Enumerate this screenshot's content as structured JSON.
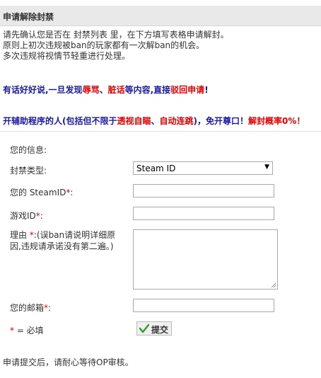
{
  "header": {
    "title": "申请解除封禁"
  },
  "intro": {
    "line1": "请先确认您是否在 封禁列表 里，在下方填写表格申请解封。",
    "line2": "原则上初次违规被ban的玩家都有一次解ban的机会。",
    "line3": "多次违规将视情节轻重进行处理。"
  },
  "warning1": {
    "p1": "有话好好说,一旦发现",
    "p2": "辱骂",
    "p3": "、",
    "p4": "脏话",
    "p5": "等内容,直接",
    "p6": "驳回申请",
    "p7": "!"
  },
  "warning2": {
    "p1": "开辅助程序的人(包括但不限于",
    "p2": "透视自瞄",
    "p3": "、",
    "p4": "自动连跳",
    "p5": ")，免开尊口！",
    "p6": "解封概率0%！"
  },
  "form": {
    "info_label": "您的信息:",
    "ban_type_label": "封禁类型:",
    "ban_type_value": "Steam ID",
    "steamid_label": "您的 SteamID",
    "gameid_label": "游戏ID",
    "reason_label": "理由",
    "reason_hint": ":(误ban请说明详细原因,违规请承诺没有第二遍。)",
    "email_label": "您的邮箱",
    "required_star": "*",
    "colon": ":",
    "required_note": " = 必填",
    "submit_label": "提交"
  },
  "footer": {
    "note": "申请提交后，请耐心等待OP审核。"
  },
  "colors": {
    "warning_blue": "#1a1aa6",
    "warning_red": "#e60000",
    "header_bg": "#e9e9e9"
  }
}
